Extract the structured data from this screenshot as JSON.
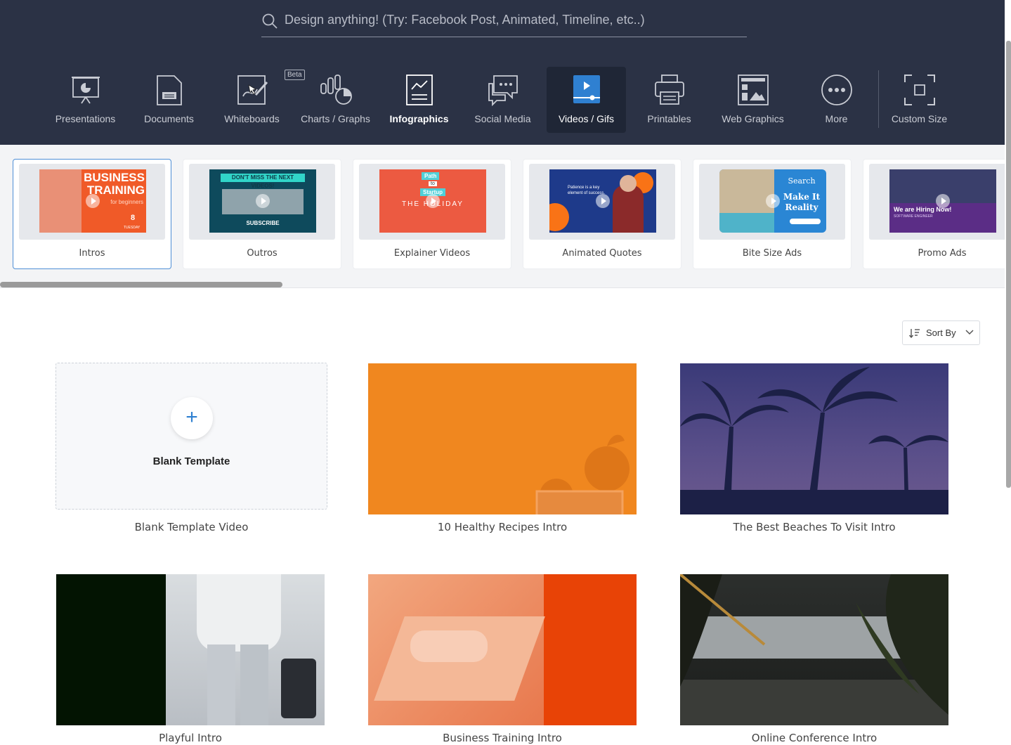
{
  "search": {
    "placeholder": "Design anything! (Try: Facebook Post, Animated, Timeline, etc..)"
  },
  "categories": [
    {
      "label": "Presentations",
      "icon": "presentation-icon"
    },
    {
      "label": "Documents",
      "icon": "document-icon"
    },
    {
      "label": "Whiteboards",
      "icon": "whiteboard-icon",
      "badge": "Beta"
    },
    {
      "label": "Charts / Graphs",
      "icon": "chart-icon"
    },
    {
      "label": "Infographics",
      "icon": "infographic-icon"
    },
    {
      "label": "Social Media",
      "icon": "chat-bubbles-icon"
    },
    {
      "label": "Videos / Gifs",
      "icon": "video-icon",
      "active": true
    },
    {
      "label": "Printables",
      "icon": "printer-icon"
    },
    {
      "label": "Web Graphics",
      "icon": "web-graphics-icon"
    },
    {
      "label": "More",
      "icon": "more-icon"
    },
    {
      "label": "Custom Size",
      "icon": "custom-size-icon"
    }
  ],
  "subcategories": [
    {
      "label": "Intros",
      "selected": true
    },
    {
      "label": "Outros"
    },
    {
      "label": "Explainer Videos"
    },
    {
      "label": "Animated Quotes"
    },
    {
      "label": "Bite Size Ads"
    },
    {
      "label": "Promo Ads"
    }
  ],
  "thumb_text": {
    "intros_title": "BUSINESS TRAINING",
    "intros_sub": "for beginners",
    "intros_date": "8",
    "intros_day": "TUESDAY",
    "outros_top": "DON'T MISS THE NEXT VIDEOS!",
    "outros_bottom": "SUBSCRIBE",
    "explainer_tag1": "Path",
    "explainer_tag2": "to",
    "explainer_tag3": "Startup",
    "explainer_main": "THE HOLIDAY",
    "quotes_text": "Patience is a key element of success.",
    "bite_line1": "Search",
    "bite_line2": "Make It",
    "bite_line3": "Reality",
    "promo_line1": "We are Hiring Now!",
    "promo_line2": "SOFTWARE ENGINEER"
  },
  "sort": {
    "label": "Sort By"
  },
  "blank": {
    "label": "Blank Template",
    "plus": "+"
  },
  "templates": [
    {
      "title": "Blank Template Video"
    },
    {
      "title": "10 Healthy Recipes Intro"
    },
    {
      "title": "The Best Beaches To Visit Intro"
    },
    {
      "title": "Playful Intro"
    },
    {
      "title": "Business Training Intro"
    },
    {
      "title": "Online Conference Intro"
    }
  ],
  "colors": {
    "header": "#2b3245",
    "accent": "#2f80d1",
    "orange": "#f0871f",
    "selected_border": "#4f8fd6"
  }
}
